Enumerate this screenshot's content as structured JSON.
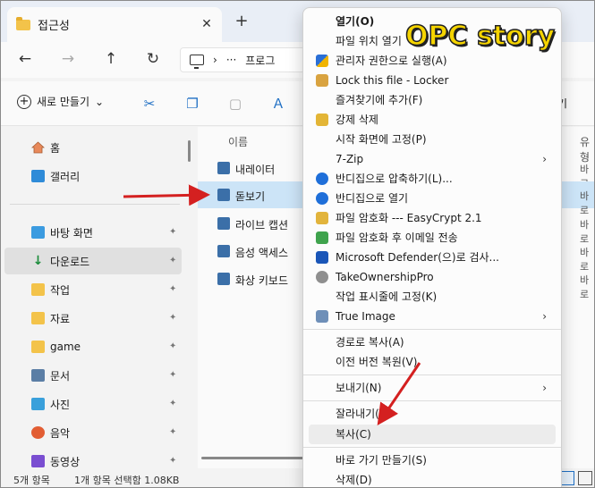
{
  "window": {
    "tab_title": "접근성",
    "close_glyph": "✕",
    "new_tab_glyph": "+"
  },
  "nav": {
    "back": "←",
    "forward": "→",
    "up": "↑",
    "refresh": "↻",
    "chevron": "›",
    "more": "···",
    "breadcrumb": "프로그"
  },
  "toolbar": {
    "new_label": "새로 만들기",
    "new_chevron": "⌄",
    "right_fragment": "기"
  },
  "sidebar": {
    "items": [
      {
        "label": "홈",
        "icon": "home-icon"
      },
      {
        "label": "갤러리",
        "icon": "gallery-icon"
      },
      {
        "label": "바탕 화면",
        "icon": "desktop-icon",
        "pinned": true
      },
      {
        "label": "다운로드",
        "icon": "download-icon",
        "pinned": true,
        "selected": true
      },
      {
        "label": "작업",
        "icon": "folder-icon",
        "pinned": true
      },
      {
        "label": "자료",
        "icon": "folder-icon",
        "pinned": true
      },
      {
        "label": "game",
        "icon": "folder-icon",
        "pinned": true
      },
      {
        "label": "문서",
        "icon": "documents-icon",
        "pinned": true
      },
      {
        "label": "사진",
        "icon": "pictures-icon",
        "pinned": true
      },
      {
        "label": "음악",
        "icon": "music-icon",
        "pinned": true
      },
      {
        "label": "동영상",
        "icon": "videos-icon",
        "pinned": true
      }
    ]
  },
  "files": {
    "col_name": "이름",
    "col_type": "유형",
    "rows": [
      {
        "name": "내레이터",
        "type": "바로"
      },
      {
        "name": "돋보기",
        "type": "바로",
        "selected": true
      },
      {
        "name": "라이브 캡션",
        "type": "바로"
      },
      {
        "name": "음성 액세스",
        "type": "바로"
      },
      {
        "name": "화상 키보드",
        "type": "바로"
      }
    ]
  },
  "status": {
    "count": "5개 항목",
    "selection": "1개 항목 선택함 1.08KB"
  },
  "context_menu": {
    "items": [
      {
        "label": "열기(O)",
        "bold": true
      },
      {
        "label": "파일 위치 열기"
      },
      {
        "label": "관리자 권한으로 실행(A)",
        "icon": "uac-shield-icon"
      },
      {
        "label": "Lock this file - Locker",
        "icon": "lock-icon"
      },
      {
        "label": "즐겨찾기에 추가(F)"
      },
      {
        "label": "강제 삭제",
        "icon": "force-delete-icon"
      },
      {
        "label": "시작 화면에 고정(P)"
      },
      {
        "label": "7-Zip",
        "submenu": true
      },
      {
        "label": "반디집으로 압축하기(L)...",
        "icon": "bandizip-icon"
      },
      {
        "label": "반디집으로 열기",
        "icon": "bandizip-icon"
      },
      {
        "label": "파일 암호화 --- EasyCrypt 2.1",
        "icon": "easycrypt-icon"
      },
      {
        "label": "파일 암호화 후 이메일 전송",
        "icon": "encrypt-mail-icon"
      },
      {
        "label": "Microsoft Defender(으)로 검사...",
        "icon": "defender-icon"
      },
      {
        "label": "TakeOwnershipPro",
        "icon": "takeownership-icon"
      },
      {
        "label": "작업 표시줄에 고정(K)"
      },
      {
        "label": "True Image",
        "icon": "true-image-icon",
        "submenu": true
      },
      {
        "label": "경로로 복사(A)"
      },
      {
        "label": "이전 버전 복원(V)"
      },
      {
        "label": "보내기(N)",
        "submenu": true
      },
      {
        "label": "잘라내기(T)"
      },
      {
        "label": "복사(C)",
        "highlighted": true
      },
      {
        "label": "바로 가기 만들기(S)"
      },
      {
        "label": "삭제(D)"
      }
    ],
    "submenu_arrow": "›"
  },
  "watermark": "OPC story",
  "colors": {
    "selection": "#cce4f7",
    "accent": "#1f6fc4",
    "annotation_arrow": "#d42020",
    "watermark": "#f5d400"
  }
}
